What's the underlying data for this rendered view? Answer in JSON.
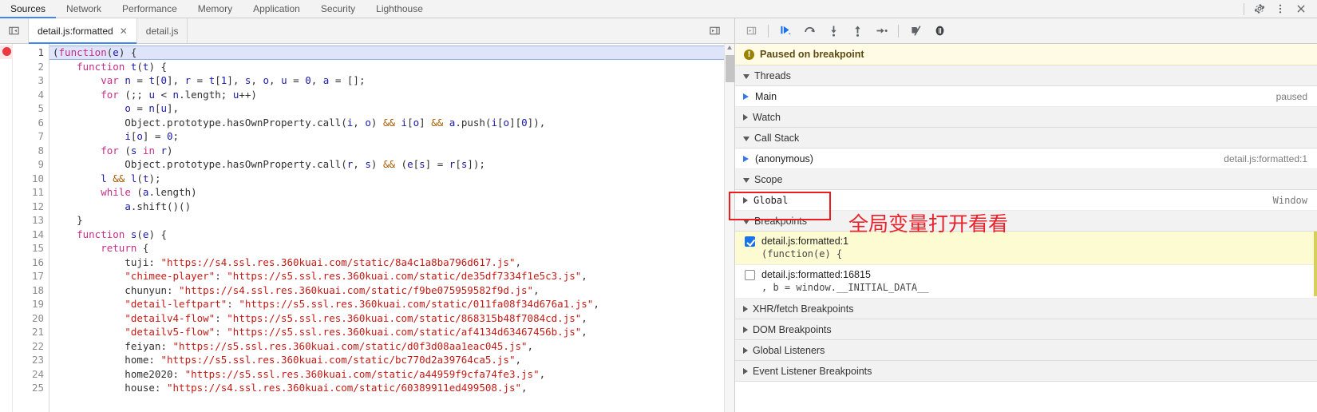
{
  "panel_tabs": [
    {
      "label": "Sources",
      "active": true
    },
    {
      "label": "Network",
      "active": false
    },
    {
      "label": "Performance",
      "active": false
    },
    {
      "label": "Memory",
      "active": false
    },
    {
      "label": "Application",
      "active": false
    },
    {
      "label": "Security",
      "active": false
    },
    {
      "label": "Lighthouse",
      "active": false
    }
  ],
  "titlebar_icons": [
    {
      "name": "gear-icon",
      "glyph": "⚙"
    },
    {
      "name": "more-options-icon",
      "glyph": "⋮"
    },
    {
      "name": "close-icon",
      "glyph": "✕"
    }
  ],
  "editor": {
    "nav_toggle_name": "show-navigator-icon",
    "file_tabs": [
      {
        "label": "detail.js:formatted",
        "active": true,
        "closable": true,
        "close_glyph": "✕"
      },
      {
        "label": "detail.js",
        "active": false,
        "closable": false
      }
    ],
    "expand_icon_name": "show-debugger-icon",
    "breakpoint_line": 1,
    "highlighted_line": 1,
    "line_numbers": [
      1,
      2,
      3,
      4,
      5,
      6,
      7,
      8,
      9,
      10,
      11,
      12,
      13,
      14,
      15,
      16,
      17,
      18,
      19,
      20,
      21,
      22,
      23,
      24,
      25
    ],
    "lines": [
      "(function(e) {",
      "    function t(t) {",
      "        var n = t[0], r = t[1], s, o, u = 0, a = [];",
      "        for (;; u < n.length; u++)",
      "            o = n[u],",
      "            Object.prototype.hasOwnProperty.call(i, o) && i[o] && a.push(i[o][0]),",
      "            i[o] = 0;",
      "        for (s in r)",
      "            Object.prototype.hasOwnProperty.call(r, s) && (e[s] = r[s]);",
      "        l && l(t);",
      "        while (a.length)",
      "            a.shift()()",
      "    }",
      "    function s(e) {",
      "        return {",
      "            tuji: \"https://s4.ssl.res.360kuai.com/static/8a4c1a8ba796d617.js\",",
      "            \"chimee-player\": \"https://s5.ssl.res.360kuai.com/static/de35df7334f1e5c3.js\",",
      "            chunyun: \"https://s4.ssl.res.360kuai.com/static/f9be075959582f9d.js\",",
      "            \"detail-leftpart\": \"https://s5.ssl.res.360kuai.com/static/011fa08f34d676a1.js\",",
      "            \"detailv4-flow\": \"https://s5.ssl.res.360kuai.com/static/868315b48f7084cd.js\",",
      "            \"detailv5-flow\": \"https://s5.ssl.res.360kuai.com/static/af4134d63467456b.js\",",
      "            feiyan: \"https://s5.ssl.res.360kuai.com/static/d0f3d08aa1eac045.js\",",
      "            home: \"https://s5.ssl.res.360kuai.com/static/bc770d2a39764ca5.js\",",
      "            home2020: \"https://s5.ssl.res.360kuai.com/static/a44959f9cfa74fe3.js\",",
      "            house: \"https://s4.ssl.res.360kuai.com/static/60389911ed499508.js\","
    ]
  },
  "debugger": {
    "toolbar": [
      {
        "name": "resume-script-execution-button",
        "title": "Resume"
      },
      {
        "name": "step-over-next-function-call-button",
        "title": "Step over"
      },
      {
        "name": "step-into-next-function-call-button",
        "title": "Step into"
      },
      {
        "name": "step-out-of-current-function-button",
        "title": "Step out"
      },
      {
        "name": "step-button",
        "title": "Step"
      },
      {
        "name": "deactivate-breakpoints-button",
        "title": "Deactivate breakpoints"
      },
      {
        "name": "pause-on-exceptions-button",
        "title": "Pause on exceptions"
      }
    ],
    "paused_banner": {
      "icon": "info-icon",
      "badge_glyph": "!",
      "text": "Paused on breakpoint"
    },
    "sections": {
      "threads": {
        "label": "Threads",
        "expanded": true,
        "rows": [
          {
            "label": "Main",
            "status": "paused",
            "selected": true
          }
        ]
      },
      "watch": {
        "label": "Watch",
        "expanded": false
      },
      "call_stack": {
        "label": "Call Stack",
        "expanded": true,
        "rows": [
          {
            "label": "(anonymous)",
            "location": "detail.js:formatted:1",
            "selected": true
          }
        ]
      },
      "scope": {
        "label": "Scope",
        "expanded": true,
        "rows": [
          {
            "label": "Global",
            "value": "Window",
            "expanded": false
          }
        ]
      },
      "breakpoints": {
        "label": "Breakpoints",
        "expanded": true,
        "items": [
          {
            "checked": true,
            "location": "detail.js:formatted:1",
            "snippet": "(function(e) {",
            "active": true
          },
          {
            "checked": false,
            "location": "detail.js:formatted:16815",
            "snippet": ", b = window.__INITIAL_DATA__",
            "active": false
          }
        ]
      },
      "xhr_fetch_breakpoints": {
        "label": "XHR/fetch Breakpoints",
        "expanded": false
      },
      "dom_breakpoints": {
        "label": "DOM Breakpoints",
        "expanded": false
      },
      "global_listeners": {
        "label": "Global Listeners",
        "expanded": false
      },
      "event_listener_breakpoints": {
        "label": "Event Listener Breakpoints",
        "expanded": false
      }
    }
  },
  "annotation": {
    "note_text": "全局变量打开看看",
    "box_color": "#ee1c1c",
    "text_color": "#e8222a"
  }
}
